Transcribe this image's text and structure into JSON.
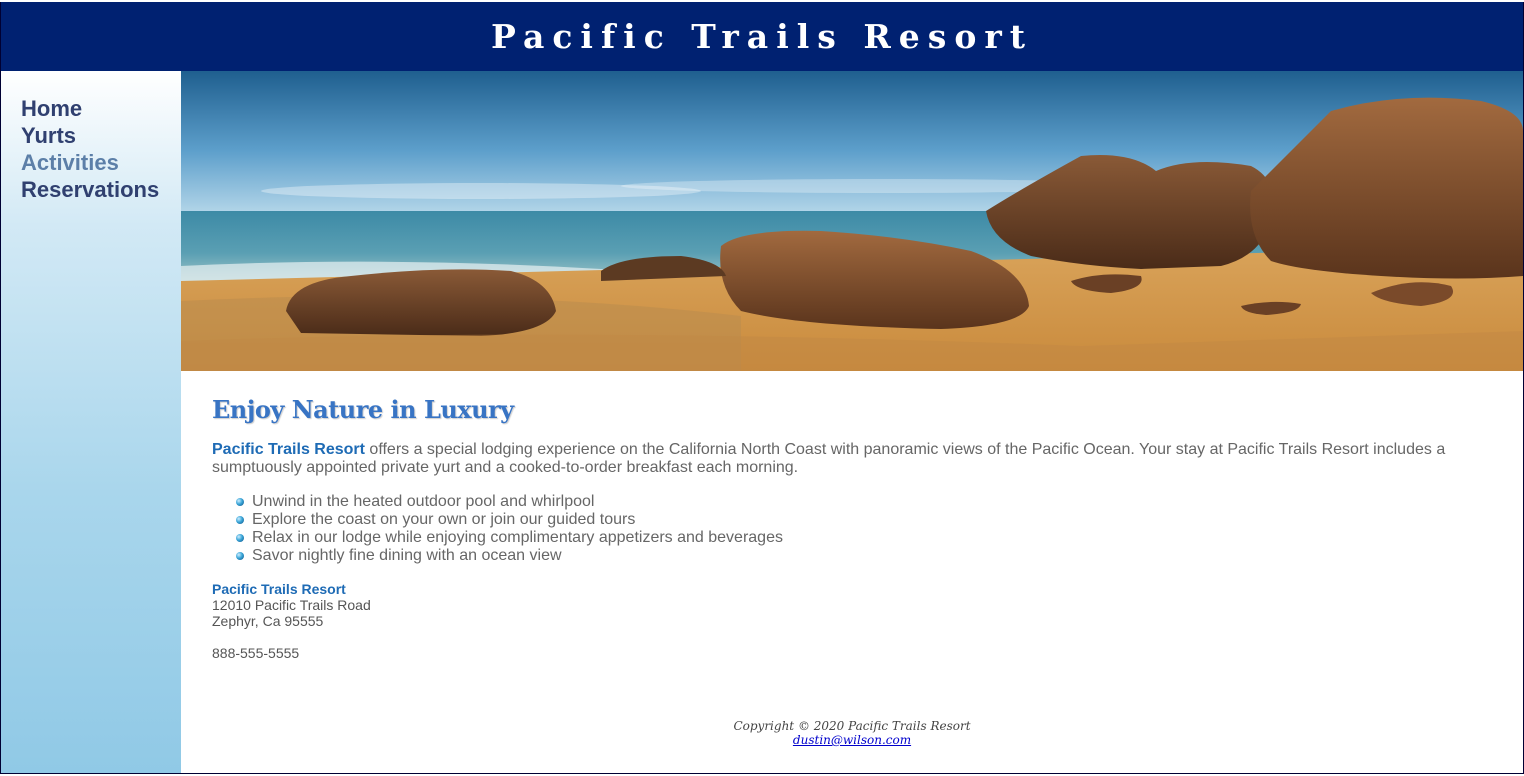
{
  "header": {
    "title": "Pacific Trails Resort"
  },
  "nav": {
    "items": [
      {
        "label": "Home"
      },
      {
        "label": "Yurts"
      },
      {
        "label": "Activities"
      },
      {
        "label": "Reservations"
      }
    ]
  },
  "main": {
    "heading": "Enjoy Nature in Luxury",
    "intro_name": "Pacific Trails Resort",
    "intro_text": " offers a special lodging experience on the California North Coast with panoramic views of the Pacific Ocean. Your stay at Pacific Trails Resort includes a sumptuously appointed private yurt and a cooked-to-order breakfast each morning.",
    "perks": [
      "Unwind in the heated outdoor pool and whirlpool",
      "Explore the coast on your own or join our guided tours",
      "Relax in our lodge while enjoying complimentary appetizers and beverages",
      "Savor nightly fine dining with an ocean view"
    ],
    "contact": {
      "name": "Pacific Trails Resort",
      "street": "12010 Pacific Trails Road",
      "city": "Zephyr, Ca 95555",
      "phone": "888-555-5555"
    }
  },
  "footer": {
    "copyright": "Copyright © 2020 Pacific Trails Resort",
    "email": "dustin@wilson.com"
  },
  "colors": {
    "header_bg": "#002171",
    "accent": "#1e6bb5",
    "nav_text": "#304070",
    "nav_current": "#5c7fa8"
  }
}
